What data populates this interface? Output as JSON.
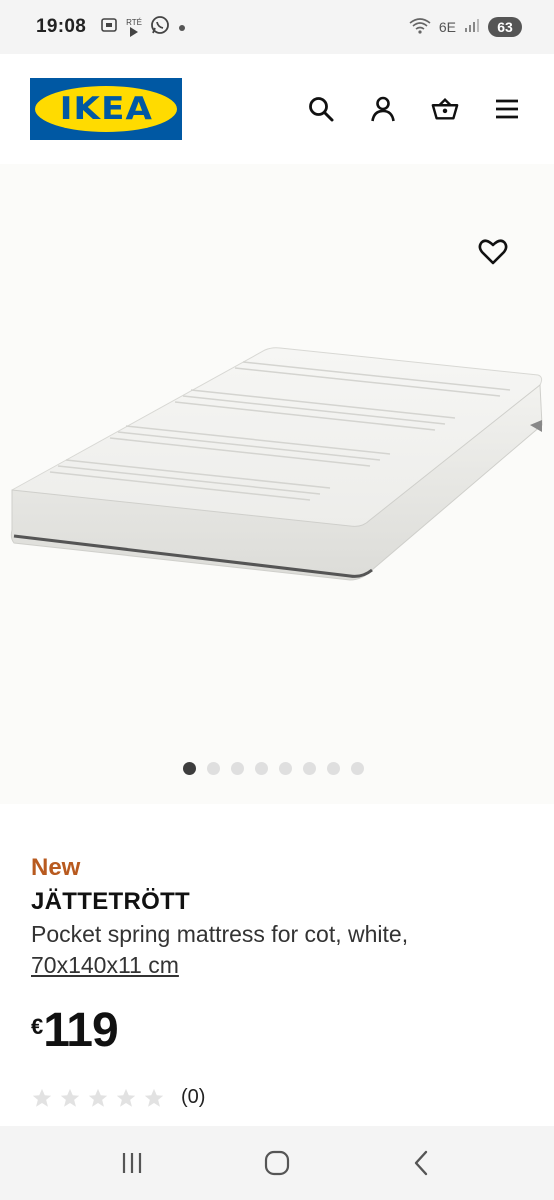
{
  "status_bar": {
    "time": "19:08",
    "left_icons": [
      "screenshot-icon",
      "rte-play-icon",
      "whatsapp-icon",
      "dot-icon"
    ],
    "rte_label": "RTÉ",
    "network": "6E",
    "battery": "63"
  },
  "header": {
    "logo_text": "IKEA",
    "icons": [
      "search-icon",
      "user-icon",
      "basket-icon",
      "menu-icon"
    ]
  },
  "gallery": {
    "dot_count": 8,
    "active_index": 0
  },
  "product": {
    "badge": "New",
    "name": "JÄTTETRÖTT",
    "description": "Pocket spring mattress for cot, white,",
    "size": "70x140x11 cm",
    "currency": "€",
    "price": "119",
    "rating_stars": 0,
    "rating_count": "(0)"
  },
  "nav_bar": {
    "buttons": [
      "recents-icon",
      "home-icon",
      "back-icon"
    ]
  },
  "colors": {
    "ikea_blue": "#0058a3",
    "ikea_yellow": "#ffdb00",
    "new_badge": "#b85a1f"
  }
}
